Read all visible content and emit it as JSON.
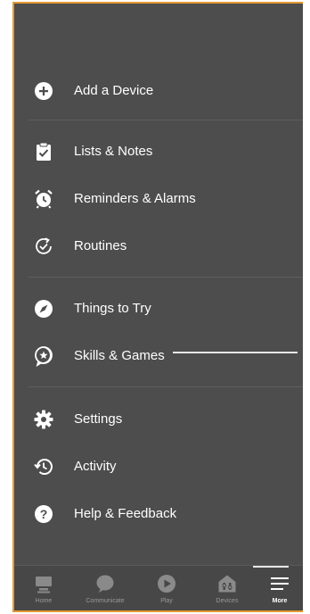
{
  "menu": {
    "items": [
      {
        "label": "Add a Device",
        "icon": "plus-circle-icon"
      },
      {
        "label": "Lists & Notes",
        "icon": "clipboard-check-icon"
      },
      {
        "label": "Reminders & Alarms",
        "icon": "alarm-clock-icon"
      },
      {
        "label": "Routines",
        "icon": "routines-check-icon"
      },
      {
        "label": "Things to Try",
        "icon": "compass-icon"
      },
      {
        "label": "Skills & Games",
        "icon": "skills-star-icon"
      },
      {
        "label": "Settings",
        "icon": "gear-icon"
      },
      {
        "label": "Activity",
        "icon": "history-icon"
      },
      {
        "label": "Help & Feedback",
        "icon": "help-icon"
      }
    ]
  },
  "tabbar": {
    "tabs": [
      {
        "label": "Home",
        "icon": "home-icon"
      },
      {
        "label": "Communicate",
        "icon": "chat-bubble-icon"
      },
      {
        "label": "Play",
        "icon": "play-icon"
      },
      {
        "label": "Devices",
        "icon": "devices-icon"
      },
      {
        "label": "More",
        "icon": "menu-icon",
        "active": true
      }
    ]
  },
  "colors": {
    "background": "#4d4d4d",
    "frame_accent": "#e39a32",
    "text": "#ffffff",
    "tab_inactive": "#9a9a9a"
  }
}
